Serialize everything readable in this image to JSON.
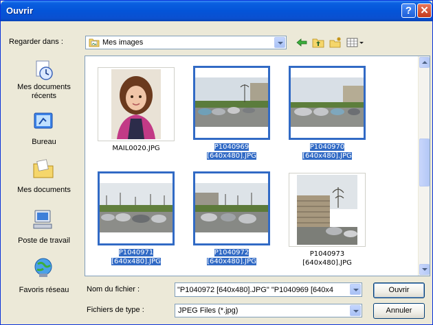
{
  "window": {
    "title": "Ouvrir",
    "help_glyph": "?",
    "close_glyph": "✕"
  },
  "lookin": {
    "label": "Regarder dans :",
    "value": "Mes images",
    "icon": "folder-pictures-icon"
  },
  "toolbar": {
    "back_icon": "back-arrow-icon",
    "up_icon": "folder-up-icon",
    "new_folder_icon": "new-folder-icon",
    "views_icon": "views-menu-icon"
  },
  "places": [
    {
      "label": "Mes documents récents",
      "icon": "recent-documents-icon"
    },
    {
      "label": "Bureau",
      "icon": "desktop-icon"
    },
    {
      "label": "Mes documents",
      "icon": "my-documents-icon"
    },
    {
      "label": "Poste de travail",
      "icon": "my-computer-icon"
    },
    {
      "label": "Favoris réseau",
      "icon": "network-places-icon"
    }
  ],
  "files": [
    {
      "line1": "MAIL0020.JPG",
      "line2": "",
      "selected": false,
      "kind": "portrait"
    },
    {
      "line1": "P1040969",
      "line2": "[640x480].JPG",
      "selected": true,
      "kind": "parking"
    },
    {
      "line1": "P1040970",
      "line2": "[640x480].JPG",
      "selected": true,
      "kind": "parking"
    },
    {
      "line1": "P1040971",
      "line2": "[640x480].JPG",
      "selected": true,
      "kind": "parking"
    },
    {
      "line1": "P1040972",
      "line2": "[640x480].JPG",
      "selected": true,
      "kind": "parking"
    },
    {
      "line1": "P1040973",
      "line2": "[640x480].JPG",
      "selected": false,
      "kind": "building"
    }
  ],
  "filename": {
    "label": "Nom du fichier :",
    "value": "\"P1040972 [640x480].JPG\" \"P1040969 [640x4"
  },
  "filetype": {
    "label": "Fichiers de type :",
    "value": "JPEG Files (*.jpg)"
  },
  "buttons": {
    "open": "Ouvrir",
    "cancel": "Annuler"
  },
  "colors": {
    "selection": "#316ac5",
    "title_bar": "#0454d8",
    "dialog_bg": "#ece9d8"
  }
}
